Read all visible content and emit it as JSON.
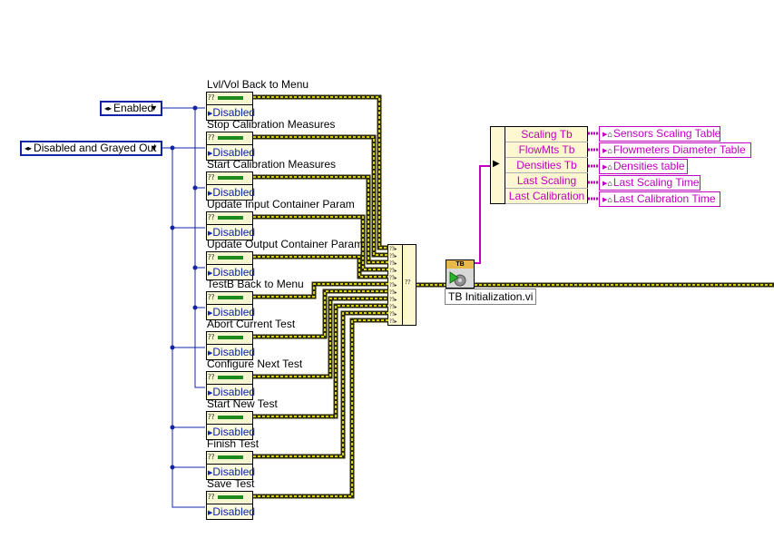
{
  "enums": {
    "enabled": "Enabled",
    "disabled_grayed": "Disabled and Grayed Out"
  },
  "property_nodes": [
    {
      "title": "Lvl/Vol Back to Menu",
      "value": "Disabled"
    },
    {
      "title": "Stop Calibration Measures",
      "value": "Disabled"
    },
    {
      "title": "Start Calibration Measures",
      "value": "Disabled"
    },
    {
      "title": "Update Input Container Param",
      "value": "Disabled"
    },
    {
      "title": "Update Output Container Param",
      "value": "Disabled"
    },
    {
      "title": "TestB Back to Menu",
      "value": "Disabled"
    },
    {
      "title": "Abort Current Test",
      "value": "Disabled"
    },
    {
      "title": "Configure Next Test",
      "value": "Disabled"
    },
    {
      "title": "Start New Test",
      "value": "Disabled"
    },
    {
      "title": "Finish Test",
      "value": "Disabled"
    },
    {
      "title": "Save Test",
      "value": "Disabled"
    }
  ],
  "subvi": {
    "banner": "TB",
    "label": "TB Initialization.vi"
  },
  "unbundle": {
    "elements": [
      "Scaling Tb",
      "FlowMts Tb",
      "Densities Tb",
      "Last Scaling",
      "Last Calibration"
    ]
  },
  "references": [
    "Sensors Scaling Table",
    "Flowmeters Diameter Table",
    "Densities table",
    "Last Scaling Time",
    "Last Calibration Time"
  ],
  "colors": {
    "enum_border": "#1024a8",
    "wire_refnum_yellow": "#d8d000",
    "wire_enum_blue": "#1024a8",
    "wire_cluster_magenta": "#c000c0",
    "disabled_text": "#1024a8"
  }
}
